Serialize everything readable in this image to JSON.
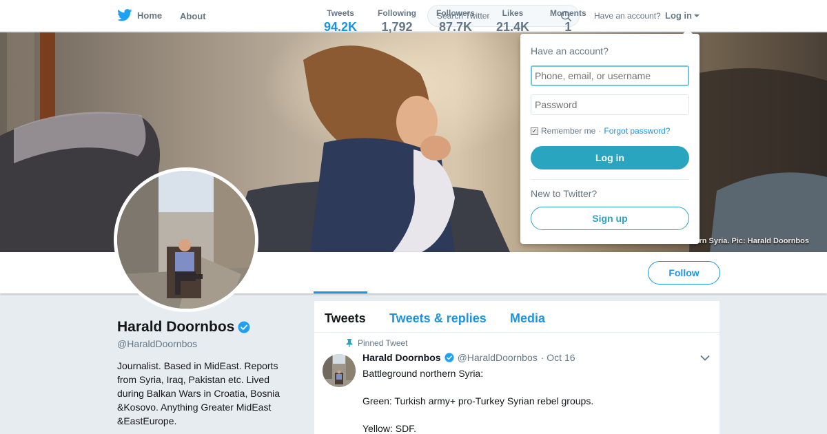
{
  "nav": {
    "home_label": "Home",
    "about_label": "About",
    "search_placeholder": "Search Twitter",
    "have_account": "Have an account?",
    "login_label": "Log in"
  },
  "banner": {
    "caption": "rn Syria. Pic: Harald Doornbos"
  },
  "stats": [
    {
      "label": "Tweets",
      "value": "94.2K"
    },
    {
      "label": "Following",
      "value": "1,792"
    },
    {
      "label": "Followers",
      "value": "87.7K"
    },
    {
      "label": "Likes",
      "value": "21.4K"
    },
    {
      "label": "Moments",
      "value": "1"
    }
  ],
  "follow_label": "Follow",
  "profile": {
    "name": "Harald Doornbos",
    "handle": "@HaraldDoornbos",
    "bio": "Journalist. Based in MidEast. Reports from Syria, Iraq, Pakistan etc. Lived during Balkan Wars in Croatia, Bosnia &Kosovo. Anything Greater MidEast &EastEurope."
  },
  "timeline": {
    "tabs": [
      "Tweets",
      "Tweets & replies",
      "Media"
    ],
    "pinned_label": "Pinned Tweet",
    "tweet": {
      "name": "Harald Doornbos",
      "handle": "@HaraldDoornbos",
      "date": "· Oct 16",
      "lines": [
        "Battleground northern Syria:",
        "",
        "Green: Turkish army+ pro-Turkey Syrian rebel groups.",
        "",
        "Yellow: SDF."
      ]
    }
  },
  "login_dropdown": {
    "title": "Have an account?",
    "username_placeholder": "Phone, email, or username",
    "password_placeholder": "Password",
    "remember_label": "Remember me",
    "separator": "·",
    "forgot_label": "Forgot password?",
    "login_button": "Log in",
    "new_label": "New to Twitter?",
    "signup_button": "Sign up"
  },
  "colors": {
    "accent": "#1b95e0",
    "login_button": "#2aa5c0",
    "verified": "#1da1f2",
    "page_bg": "#e6ecf0"
  },
  "icons": {
    "logo": "twitter-bird-icon",
    "search": "search-icon",
    "verified": "verified-badge-icon",
    "pin": "pin-icon",
    "caret": "caret-down-icon"
  }
}
